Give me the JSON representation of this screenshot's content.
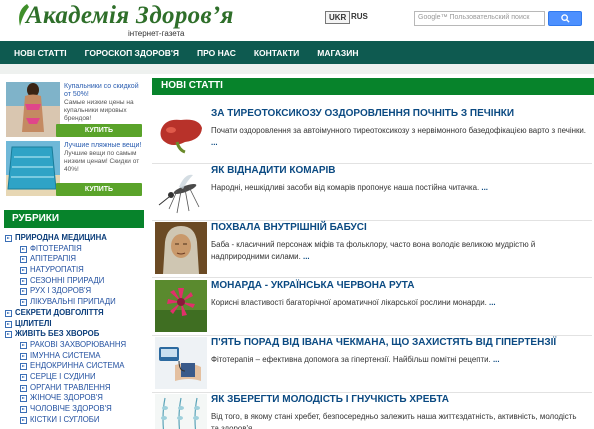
{
  "header": {
    "logo_text": "Академія Здоров’я",
    "tagline": "інтернет-газета",
    "lang_ukr": "UKR",
    "lang_rus": "RUS",
    "search_placeholder": "Google™ Пользовательский поиск"
  },
  "nav": {
    "items": [
      "НОВІ СТАТТІ",
      "ГОРОСКОП ЗДОРОВ'Я",
      "ПРО НАС",
      "КОНТАКТИ",
      "МАГАЗИН"
    ]
  },
  "ads": [
    {
      "title": "Купальники со скидкой от 50%!",
      "text": "Самые низкие цены на купальники мировых брендов!",
      "button": "КУПИТЬ"
    },
    {
      "title": "Лучшие пляжные вещи!",
      "text": "Лучшие вещи по самым низким ценам! Скидки от 40%!",
      "button": "КУПИТЬ"
    }
  ],
  "rubrics": {
    "title": "РУБРИКИ",
    "items": [
      {
        "label": "ПРИРОДНА МЕДИЦИНА",
        "level": 0
      },
      {
        "label": "ФІТОТЕРАПІЯ",
        "level": 1
      },
      {
        "label": "АПІТЕРАПІЯ",
        "level": 1
      },
      {
        "label": "НАТУРОПАТІЯ",
        "level": 1
      },
      {
        "label": "СЕЗОННІ ПРИРАДИ",
        "level": 1
      },
      {
        "label": "РУХ І ЗДОРОВ'Я",
        "level": 1
      },
      {
        "label": "ЛІКУВАЛЬНІ ПРИПАДИ",
        "level": 1
      },
      {
        "label": "СЕКРЕТИ ДОВГОЛІТТЯ",
        "level": 0
      },
      {
        "label": "ЦІЛИТЕЛІ",
        "level": 0
      },
      {
        "label": "ЖИВІТЬ БЕЗ ХВОРОБ",
        "level": 0
      },
      {
        "label": "РАКОВІ ЗАХВОРЮВАННЯ",
        "level": 1
      },
      {
        "label": "ІМУННА СИСТЕМА",
        "level": 1
      },
      {
        "label": "ЕНДОКРИННА СИСТЕМА",
        "level": 1
      },
      {
        "label": "СЕРЦЕ І СУДИНИ",
        "level": 1
      },
      {
        "label": "ОРГАНИ ТРАВЛЕННЯ",
        "level": 1
      },
      {
        "label": "ЖІНОЧЕ ЗДОРОВ'Я",
        "level": 1
      },
      {
        "label": "ЧОЛОВІЧЕ ЗДОРОВ'Я",
        "level": 1
      },
      {
        "label": "КІСТКИ І СУГЛОБИ",
        "level": 1
      }
    ]
  },
  "main": {
    "title": "НОВІ СТАТТІ",
    "more": "...",
    "articles": [
      {
        "title": "ЗА ТИРЕОТОКСИКОЗУ ОЗДОРОВЛЕННЯ ПОЧНІТЬ З ПЕЧІНКИ",
        "text": "Почати оздоровлення за автоімунного тиреотоксикозу з нервімонного базедофікацією варто з печінки."
      },
      {
        "title": "ЯК ВІДНАДИТИ КОМАРІВ",
        "text": "Народні, нешкідливі засоби від комарів пропонує наша постійна читачка."
      },
      {
        "title": "ПОХВАЛА ВНУТРІШНІЙ БАБУСІ",
        "text": "Баба - класичний персонаж міфів та фольклору, часто вона володіє великою мудрістю й надприродними силами."
      },
      {
        "title": "МОНАРДА - УКРАЇНСЬКА ЧЕРВОНА РУТА",
        "text": "Корисні властивості багаторічної ароматичної лікарської рослини монарди."
      },
      {
        "title": "П'ЯТЬ ПОРАД ВІД ІВАНА ЧЕКМАНА, ЩО ЗАХИСТЯТЬ ВІД ГІПЕРТЕНЗІЇ",
        "text": "Фітотерапія – ефективна допомога за гіпертензії. Найбільш помітні рецепти."
      },
      {
        "title": "ЯК ЗБЕРЕГТИ МОЛОДІСТЬ І ГНУЧКІСТЬ ХРЕБТА",
        "text": "Від того, в якому стані хребет, безпосередньо залежить наша життєздатність, активність, молодість та здоров'я."
      }
    ]
  },
  "colors": {
    "nav_bg": "#0e5a50",
    "section_head": "#07832b",
    "link": "#0b4a82",
    "buy_button": "#5aa32a"
  }
}
